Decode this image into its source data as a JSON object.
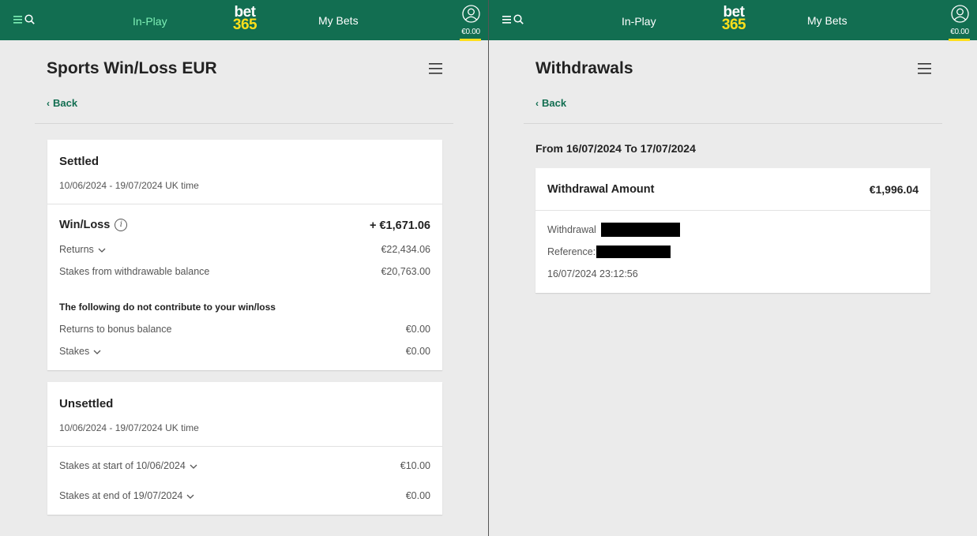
{
  "header": {
    "in_play": "In-Play",
    "logo_line1": "bet",
    "logo_line2": "365",
    "my_bets": "My Bets",
    "balance": "€0.00",
    "colors": {
      "bar": "#126e51",
      "accent_yellow": "#ffdf1b",
      "active_nav": "#7ff0b6"
    }
  },
  "left": {
    "title": "Sports Win/Loss EUR",
    "back": "Back",
    "settled": {
      "title": "Settled",
      "date_range": "10/06/2024 - 19/07/2024 UK time",
      "win_loss_label": "Win/Loss",
      "win_loss_value": "+ €1,671.06",
      "returns_label": "Returns",
      "returns_value": "€22,434.06",
      "stakes_withdrawable_label": "Stakes from withdrawable balance",
      "stakes_withdrawable_value": "€20,763.00",
      "note": "The following do not contribute to your win/loss",
      "returns_bonus_label": "Returns to bonus balance",
      "returns_bonus_value": "€0.00",
      "stakes_label": "Stakes",
      "stakes_value": "€0.00"
    },
    "unsettled": {
      "title": "Unsettled",
      "date_range": "10/06/2024 - 19/07/2024 UK time",
      "start_label": "Stakes at start of 10/06/2024",
      "start_value": "€10.00",
      "end_label": "Stakes at end of 19/07/2024",
      "end_value": "€0.00"
    }
  },
  "right": {
    "title": "Withdrawals",
    "back": "Back",
    "period": "From 16/07/2024 To 17/07/2024",
    "card": {
      "amount_label": "Withdrawal Amount",
      "amount_value": "€1,996.04",
      "withdrawal_label": "Withdrawal",
      "reference_label": "Reference:",
      "timestamp": "16/07/2024 23:12:56"
    }
  }
}
